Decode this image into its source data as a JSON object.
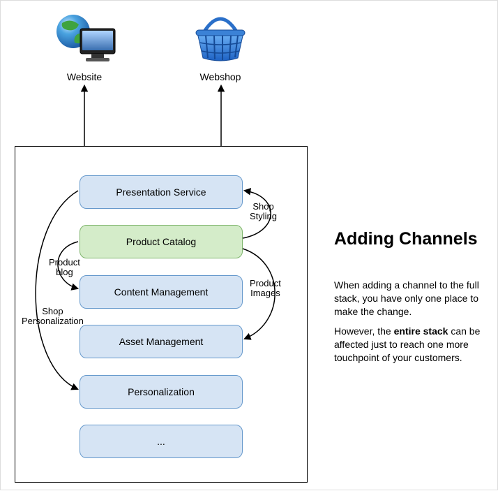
{
  "icons": {
    "website": {
      "label": "Website"
    },
    "webshop": {
      "label": "Webshop"
    }
  },
  "stack": {
    "boxes": [
      "Presentation Service",
      "Product Catalog",
      "Content Management",
      "Asset Management",
      "Personalization",
      "..."
    ]
  },
  "annotations": {
    "shop_styling": "Shop\nStyling",
    "product_blog": "Product\nblog",
    "product_images": "Product\nImages",
    "shop_personalization": "Shop\nPersonalization"
  },
  "sidebar": {
    "heading": "Adding Channels",
    "p1": "When adding a channel to the full stack, you have only one place to make the change.",
    "p2_a": "However, the ",
    "p2_b": "entire stack",
    "p2_c": " can be affected just to reach one more touchpoint of your customers."
  }
}
